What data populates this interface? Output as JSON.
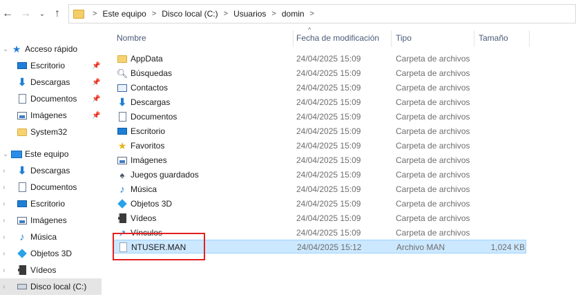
{
  "nav": {
    "back_icon": "arrow-left-icon",
    "forward_icon": "arrow-right-icon",
    "dropdown_icon": "chevron-down-icon",
    "up_icon": "arrow-up-icon"
  },
  "address_bar": {
    "crumbs": [
      "Este equipo",
      "Disco local (C:)",
      "Usuarios",
      "domin"
    ],
    "separator": ">"
  },
  "sidebar": {
    "items": [
      {
        "label": "Acceso rápido",
        "icon": "star-icon"
      },
      {
        "label": "Escritorio",
        "icon": "desktop-icon",
        "pinned": true
      },
      {
        "label": "Descargas",
        "icon": "download-icon",
        "pinned": true
      },
      {
        "label": "Documentos",
        "icon": "documents-icon",
        "pinned": true
      },
      {
        "label": "Imágenes",
        "icon": "pictures-icon",
        "pinned": true
      },
      {
        "label": "System32",
        "icon": "folder-icon"
      },
      {
        "label": "Este equipo",
        "icon": "computer-icon"
      },
      {
        "label": "Descargas",
        "icon": "download-icon"
      },
      {
        "label": "Documentos",
        "icon": "documents-icon"
      },
      {
        "label": "Escritorio",
        "icon": "desktop-icon"
      },
      {
        "label": "Imágenes",
        "icon": "pictures-icon"
      },
      {
        "label": "Música",
        "icon": "music-icon"
      },
      {
        "label": "Objetos 3D",
        "icon": "3d-objects-icon"
      },
      {
        "label": "Vídeos",
        "icon": "videos-icon"
      },
      {
        "label": "Disco local (C:)",
        "icon": "drive-icon",
        "selected": true
      }
    ]
  },
  "columns": {
    "name": "Nombre",
    "date": "Fecha de modificación",
    "type": "Tipo",
    "size": "Tamaño"
  },
  "files": [
    {
      "name": "AppData",
      "date": "24/04/2025 15:09",
      "type": "Carpeta de archivos",
      "size": "",
      "icon": "folder-icon"
    },
    {
      "name": "Búsquedas",
      "date": "24/04/2025 15:09",
      "type": "Carpeta de archivos",
      "size": "",
      "icon": "search-icon"
    },
    {
      "name": "Contactos",
      "date": "24/04/2025 15:09",
      "type": "Carpeta de archivos",
      "size": "",
      "icon": "contacts-icon"
    },
    {
      "name": "Descargas",
      "date": "24/04/2025 15:09",
      "type": "Carpeta de archivos",
      "size": "",
      "icon": "download-icon"
    },
    {
      "name": "Documentos",
      "date": "24/04/2025 15:09",
      "type": "Carpeta de archivos",
      "size": "",
      "icon": "documents-icon"
    },
    {
      "name": "Escritorio",
      "date": "24/04/2025 15:09",
      "type": "Carpeta de archivos",
      "size": "",
      "icon": "desktop-icon"
    },
    {
      "name": "Favoritos",
      "date": "24/04/2025 15:09",
      "type": "Carpeta de archivos",
      "size": "",
      "icon": "favorites-icon"
    },
    {
      "name": "Imágenes",
      "date": "24/04/2025 15:09",
      "type": "Carpeta de archivos",
      "size": "",
      "icon": "pictures-icon"
    },
    {
      "name": "Juegos guardados",
      "date": "24/04/2025 15:09",
      "type": "Carpeta de archivos",
      "size": "",
      "icon": "saved-games-icon"
    },
    {
      "name": "Música",
      "date": "24/04/2025 15:09",
      "type": "Carpeta de archivos",
      "size": "",
      "icon": "music-icon"
    },
    {
      "name": "Objetos 3D",
      "date": "24/04/2025 15:09",
      "type": "Carpeta de archivos",
      "size": "",
      "icon": "3d-objects-icon"
    },
    {
      "name": "Vídeos",
      "date": "24/04/2025 15:09",
      "type": "Carpeta de archivos",
      "size": "",
      "icon": "videos-icon"
    },
    {
      "name": "Vínculos",
      "date": "24/04/2025 15:09",
      "type": "Carpeta de archivos",
      "size": "",
      "icon": "links-icon"
    },
    {
      "name": "NTUSER.MAN",
      "date": "24/04/2025 15:12",
      "type": "Archivo MAN",
      "size": "1,024 KB",
      "icon": "file-icon",
      "selected": true
    }
  ],
  "highlight_color": "#e41f1f",
  "selection_color": "#cce8ff"
}
